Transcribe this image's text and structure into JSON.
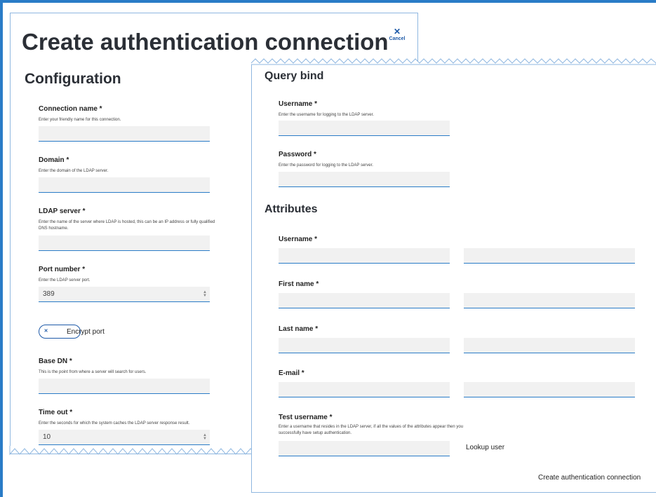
{
  "page": {
    "title": "Create authentication connection",
    "cancel_label": "Cancel",
    "cancel_icon": "close-icon"
  },
  "configuration": {
    "title": "Configuration",
    "connection_name": {
      "label": "Connection name *",
      "help": "Enter your friendly name for this connection.",
      "value": ""
    },
    "domain": {
      "label": "Domain *",
      "help": "Enter the domain of the LDAP server.",
      "value": ""
    },
    "ldap_server": {
      "label": "LDAP server *",
      "help": "Enter the name of the server where LDAP is hosted, this can be an IP address or fully qualified DNS hostname.",
      "value": ""
    },
    "port_number": {
      "label": "Port number *",
      "help": "Enter the LDAP server port.",
      "value": "389"
    },
    "encrypt_port": {
      "label": "Encrypt port",
      "state": "off"
    },
    "base_dn": {
      "label": "Base DN *",
      "help": "This is the point from where a server will search for users.",
      "value": ""
    },
    "time_out": {
      "label": "Time out *",
      "help": "Enter the seconds for which the system caches the LDAP server response result.",
      "value": "10"
    }
  },
  "query_bind": {
    "title": "Query bind",
    "username": {
      "label": "Username *",
      "help": "Enter the username for logging to the LDAP server.",
      "value": ""
    },
    "password": {
      "label": "Password *",
      "help": "Enter the password for logging to the LDAP server.",
      "value": ""
    }
  },
  "attributes": {
    "title": "Attributes",
    "username_label": "Username *",
    "first_name_label": "First name *",
    "last_name_label": "Last name *",
    "email_label": "E-mail *",
    "test_username": {
      "label": "Test username *",
      "help": "Enter a username that resides in the LDAP server, if all the values of the attributes appear then you successfully have setup authentication.",
      "value": ""
    },
    "lookup_label": "Lookup user"
  },
  "actions": {
    "create_label": "Create authentication connection"
  },
  "colors": {
    "accent": "#2a7cc7",
    "input_bg": "#f1f1f1",
    "heading": "#2b2f36"
  }
}
